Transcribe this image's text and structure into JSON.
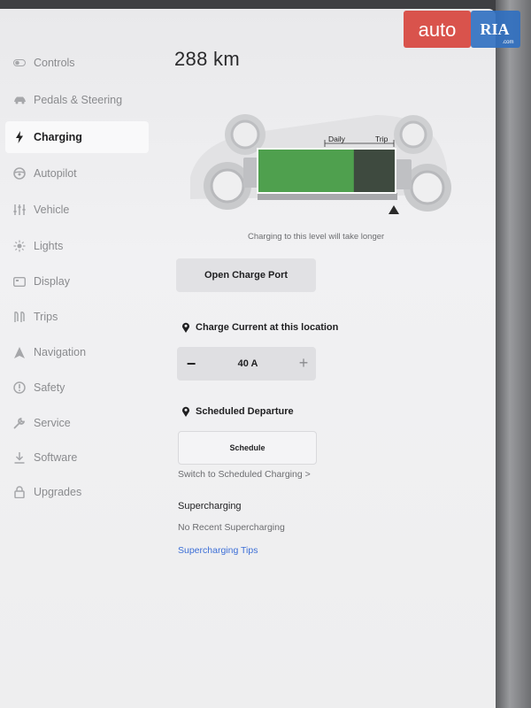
{
  "sidebar": {
    "items": [
      {
        "label": "Controls",
        "icon": "toggle-icon",
        "active": false
      },
      {
        "label": "Pedals & Steering",
        "icon": "car-icon",
        "active": false
      },
      {
        "label": "Charging",
        "icon": "lightning-bolt-icon",
        "active": true
      },
      {
        "label": "Autopilot",
        "icon": "steering-wheel-icon",
        "active": false
      },
      {
        "label": "Vehicle",
        "icon": "sliders-icon",
        "active": false
      },
      {
        "label": "Lights",
        "icon": "sun-icon",
        "active": false
      },
      {
        "label": "Display",
        "icon": "display-icon",
        "active": false
      },
      {
        "label": "Trips",
        "icon": "trips-icon",
        "active": false
      },
      {
        "label": "Navigation",
        "icon": "navigation-arrow-icon",
        "active": false
      },
      {
        "label": "Safety",
        "icon": "safety-icon",
        "active": false
      },
      {
        "label": "Service",
        "icon": "wrench-icon",
        "active": false
      },
      {
        "label": "Software",
        "icon": "download-icon",
        "active": false
      },
      {
        "label": "Upgrades",
        "icon": "lock-icon",
        "active": false
      }
    ]
  },
  "charging": {
    "range": "288 km",
    "battery": {
      "daily_label": "Daily",
      "trip_label": "Trip",
      "charge_fraction": 0.7,
      "charge_limit_fraction": 1.0,
      "fill_color": "#4fa04e",
      "empty_color": "#3e4a3f"
    },
    "level_note": "Charging to this level will take longer",
    "open_port_label": "Open Charge Port",
    "charge_current": {
      "heading": "Charge Current at this location",
      "value": "40 A"
    },
    "scheduled_departure": {
      "heading": "Scheduled Departure",
      "button_label": "Schedule",
      "switch_link": "Switch to Scheduled Charging >"
    },
    "supercharging": {
      "title": "Supercharging",
      "status": "No Recent Supercharging",
      "tips_link": "Supercharging Tips"
    }
  },
  "watermark": {
    "brand_a": "auto",
    "brand_b": "RIA",
    "brand_sub": ".com",
    "red": "#d7433b",
    "blue": "#2f6fc1"
  }
}
